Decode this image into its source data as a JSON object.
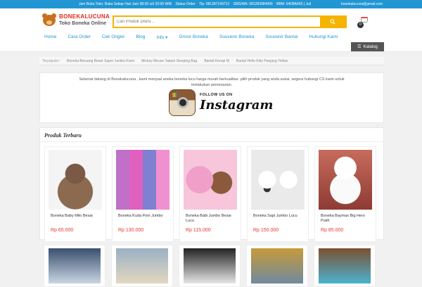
{
  "topbar": {
    "hours": "Jam Buka Toko: Buka Setiap Hari Jam 08:00 s/d 20:00 WIB",
    "order": "Status Order",
    "tlp": "Tlp: 081387149713",
    "sms": "SMS/WA: 081283984999",
    "bbm": "BBM: 54D8A665 | Juli",
    "email": "bonekalucuna@gmail.com"
  },
  "header": {
    "brand": "BONEKALUCUNA",
    "tagline": "Toko Boneka Online",
    "search_placeholder": "Cari Produk Disini...",
    "cart_count": "0"
  },
  "nav": {
    "items": [
      "Home",
      "Cara Order",
      "Cek Ongkir",
      "Blog",
      "Info ▾",
      "Grosir Boneka",
      "Souvenir Boneka",
      "Souvenir Bantal",
      "Hubungi Kami"
    ],
    "katalog": "Katalog"
  },
  "popular": {
    "label": "Terpopuler:",
    "items": [
      "Boneka Beruang Besar Super Jumbo Krem",
      "Mickey Mouse Tatami Sleeping Bag",
      "Bantal Kerupi M",
      "Bantal Hello Kitty Panjang Yellow"
    ]
  },
  "welcome": {
    "text": "Selamat datang di Bonekalucuna , kami menjual aneka boneka lucu harga murah berkualitas. pilih produk yang anda sukai, segera hubungi CS kami untuk melakukan pemesanan.",
    "follow": "FOLLOW US ON",
    "instagram": "Instagram"
  },
  "products": {
    "title": "Produk Terbaru",
    "items": [
      {
        "name": "Boneka Baby Milo Besar",
        "price": "Rp 65.000"
      },
      {
        "name": "Boneka Kuda Poni Jumbo",
        "price": "Rp 130.000"
      },
      {
        "name": "Boneka Babi Jumbo Besar Lucu",
        "price": "Rp 115.000"
      },
      {
        "name": "Boneka Sapi Jumbo Lucu",
        "price": "Rp 150.000"
      },
      {
        "name": "Boneka Baymax Big Hero Putih",
        "price": "Rp 85.000"
      }
    ]
  }
}
